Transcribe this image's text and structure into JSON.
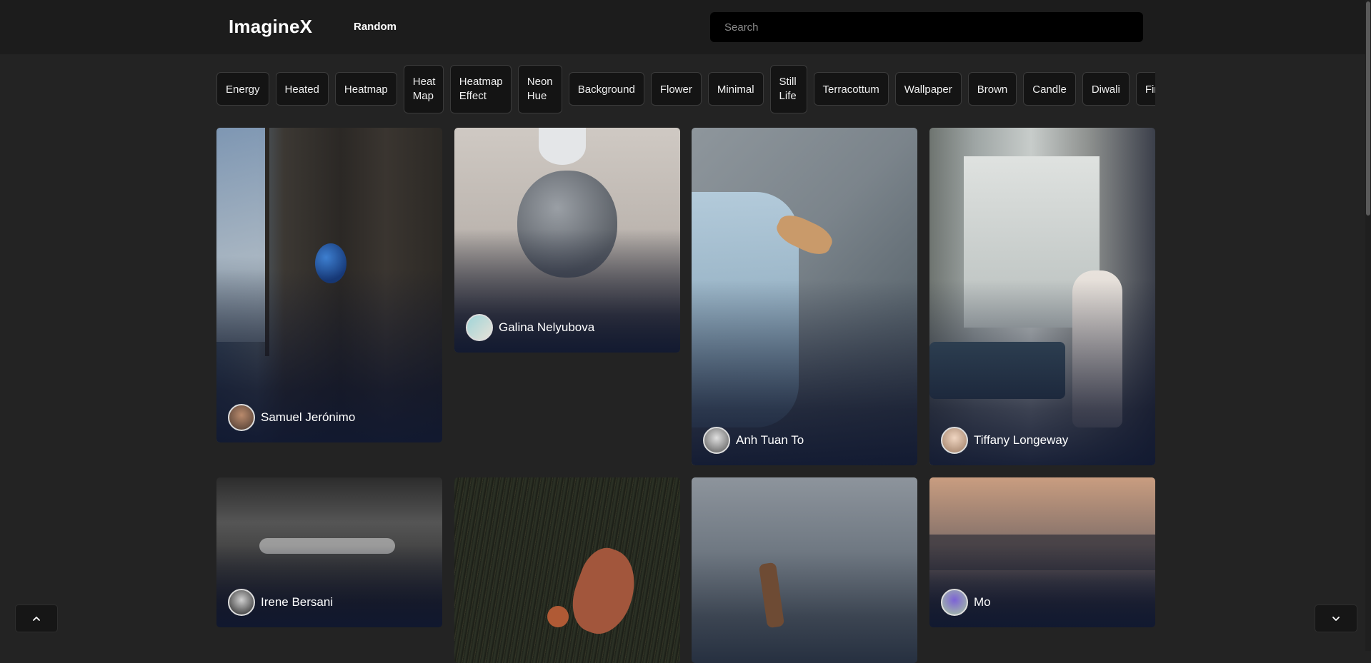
{
  "header": {
    "logo": "ImagineX",
    "random_link": "Random",
    "search_placeholder": "Search"
  },
  "tags": [
    "Energy",
    "Heated",
    "Heatmap",
    "Heat Map",
    "Heatmap Effect",
    "Neon Hue",
    "Background",
    "Flower",
    "Minimal",
    "Still Life",
    "Terracottum",
    "Wallpaper",
    "Brown",
    "Candle",
    "Diwali",
    "Fir"
  ],
  "cards": [
    {
      "author": "Samuel Jerónimo"
    },
    {
      "author": "Galina Nelyubova"
    },
    {
      "author": "Anh Tuan To"
    },
    {
      "author": "Tiffany Longeway"
    },
    {
      "author": "Irene Bersani"
    },
    {
      "author": ""
    },
    {
      "author": ""
    },
    {
      "author": "Mo"
    }
  ],
  "buttons": {
    "scroll_up_icon": "chevron-up-icon",
    "scroll_down_icon": "chevron-down-icon"
  },
  "colors": {
    "page_bg": "#232323",
    "header_bg": "#1c1c1c",
    "tag_bg": "#141414",
    "card_overlay": "#0e142a"
  }
}
